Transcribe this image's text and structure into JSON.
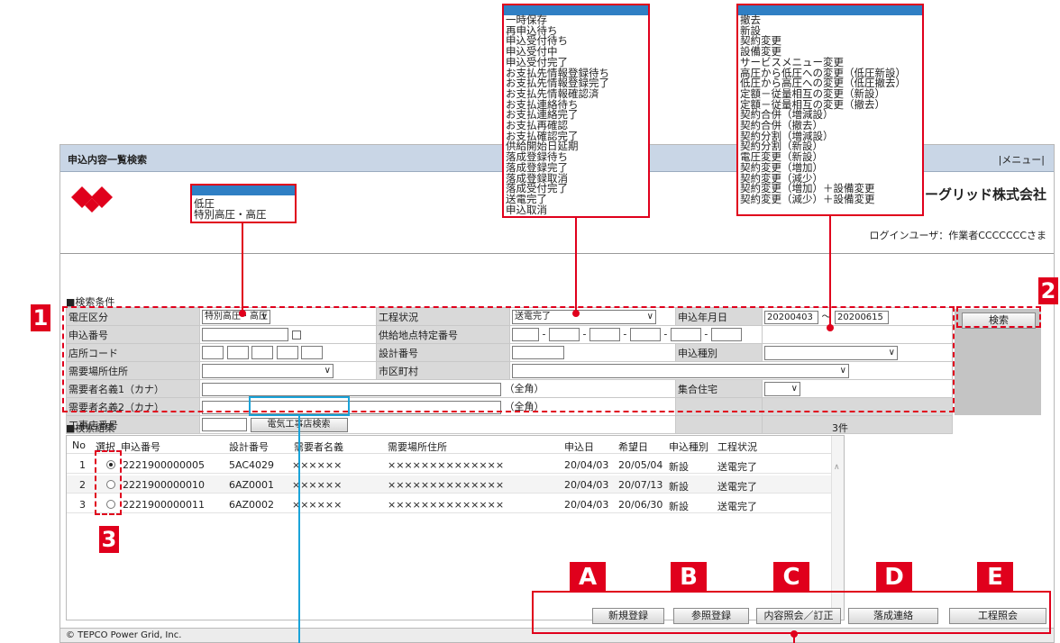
{
  "window": {
    "title": "申込内容一覧検索",
    "menu": "|メニュー|",
    "company": "ワーグリッド株式会社",
    "login_user": "ログインユーザ：作業者CCCCCCCさま",
    "footer": "© TEPCO Power Grid, Inc."
  },
  "search": {
    "section_label": "■検索条件",
    "voltage_label": "電圧区分",
    "voltage_value": "特別高圧・高圧",
    "process_label": "工程状況",
    "process_value": "送電完了",
    "date_label": "申込年月日",
    "date_from": "20200403",
    "date_sep": "～",
    "date_to": "20200615",
    "app_no_label": "申込番号",
    "supply_point_label": "供給地点特定番号",
    "store_code_label": "店所コード",
    "design_no_label": "設計番号",
    "app_type_label": "申込種別",
    "addr_label": "需要場所住所",
    "city_label": "市区町村",
    "name1_label": "需要者名義1（カナ）",
    "name1_hint": "（全角）",
    "name2_label": "需要者名義2（カナ）",
    "name2_hint": "（全角）",
    "housing_label": "集合住宅",
    "contractor_label": "工事店番号",
    "contractor_button": "電気工事店検索",
    "search_button": "検索"
  },
  "results": {
    "section_label": "■検索結果",
    "count": "3件",
    "headers": [
      "No",
      "選択",
      "申込番号",
      "設計番号",
      "需要者名義",
      "需要場所住所",
      "申込日",
      "希望日",
      "申込種別",
      "工程状況"
    ],
    "rows": [
      {
        "no": "1",
        "selected": true,
        "app_no": "2221900000005",
        "design_no": "5AC4029",
        "name": "××××××",
        "addr": "××××××××××××××",
        "app_date": "20/04/03",
        "hope_date": "20/05/04",
        "type": "新設",
        "status": "送電完了"
      },
      {
        "no": "2",
        "selected": false,
        "app_no": "2221900000010",
        "design_no": "6AZ0001",
        "name": "××××××",
        "addr": "××××××××××××××",
        "app_date": "20/04/03",
        "hope_date": "20/07/13",
        "type": "新設",
        "status": "送電完了"
      },
      {
        "no": "3",
        "selected": false,
        "app_no": "2221900000011",
        "design_no": "6AZ0002",
        "name": "××××××",
        "addr": "××××××××××××××",
        "app_date": "20/04/03",
        "hope_date": "20/06/30",
        "type": "新設",
        "status": "送電完了"
      }
    ]
  },
  "actions": {
    "new": "新規登録",
    "ref": "参照登録",
    "view": "内容照会／訂正",
    "bid": "落成連絡",
    "process": "工程照会"
  },
  "callouts": {
    "n1": "1",
    "n2": "2",
    "n3": "3",
    "a": "A",
    "b": "B",
    "c": "C",
    "d": "D",
    "e": "E"
  },
  "popup_voltage": [
    "低圧",
    "特別高圧・高圧"
  ],
  "popup_process": [
    "一時保存",
    "再申込待ち",
    "申込受付待ち",
    "申込受付中",
    "申込受付完了",
    "お支払先情報登録待ち",
    "お支払先情報登録完了",
    "お支払先情報確認済",
    "お支払連絡待ち",
    "お支払連絡完了",
    "お支払再確認",
    "お支払確認完了",
    "供給開始日延期",
    "落成登録待ち",
    "落成登録完了",
    "落成登録取消",
    "落成受付完了",
    "送電完了",
    "申込取消"
  ],
  "popup_type": [
    "撤去",
    "新設",
    "契約変更",
    "設備変更",
    "サービスメニュー変更",
    "高圧から低圧への変更（低圧新設）",
    "低圧から高圧への変更（低圧撤去）",
    "定額－従量相互の変更（新設）",
    "定額－従量相互の変更（撤去）",
    "契約合併（増減設）",
    "契約合併（撤去）",
    "契約分割（増減設）",
    "契約分割（新設）",
    "電圧変更（新設）",
    "契約変更（増加）",
    "契約変更（減少）",
    "契約変更（増加）＋設備変更",
    "契約変更（減少）＋設備変更"
  ],
  "colors": {
    "accent_red": "#e0001c",
    "highlight_blue": "#1aa3d9",
    "list_header_blue": "#2f7fc4"
  }
}
